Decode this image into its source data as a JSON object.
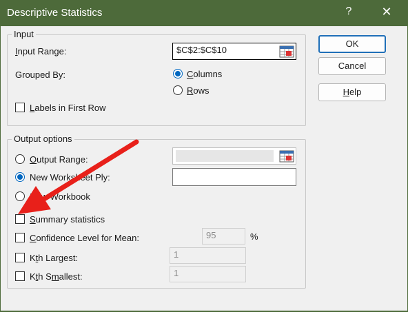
{
  "window": {
    "title": "Descriptive Statistics",
    "help_glyph": "?",
    "close_glyph": "✕",
    "titlebar_color": "#4d6a3a"
  },
  "input_group": {
    "legend": "Input",
    "input_range_label": "Input Range:",
    "input_range_value": "$C$2:$C$10",
    "grouped_by_label": "Grouped By:",
    "columns_label": "Columns",
    "rows_label": "Rows",
    "grouped_by_selected": "Columns",
    "labels_first_row_label": "Labels in First Row",
    "labels_first_row_checked": false
  },
  "output_group": {
    "legend": "Output options",
    "output_range_label": "Output Range:",
    "output_range_value": "",
    "new_worksheet_label": "New Worksheet Ply:",
    "new_worksheet_value": "",
    "new_workbook_label": "New Workbook",
    "selected": "New Worksheet Ply",
    "summary_label": "Summary statistics",
    "summary_checked": false,
    "confidence_label": "Confidence Level for Mean:",
    "confidence_value": "95",
    "confidence_unit": "%",
    "kth_largest_label": "Kth Largest:",
    "kth_largest_value": "1",
    "kth_smallest_label": "Kth Smallest:",
    "kth_smallest_value": "1"
  },
  "buttons": {
    "ok": "OK",
    "cancel": "Cancel",
    "help": "Help"
  },
  "annotation": {
    "arrow_color": "#e8201a",
    "arrow_icon": "red-arrow-icon"
  },
  "accent_color": "#0067c0"
}
